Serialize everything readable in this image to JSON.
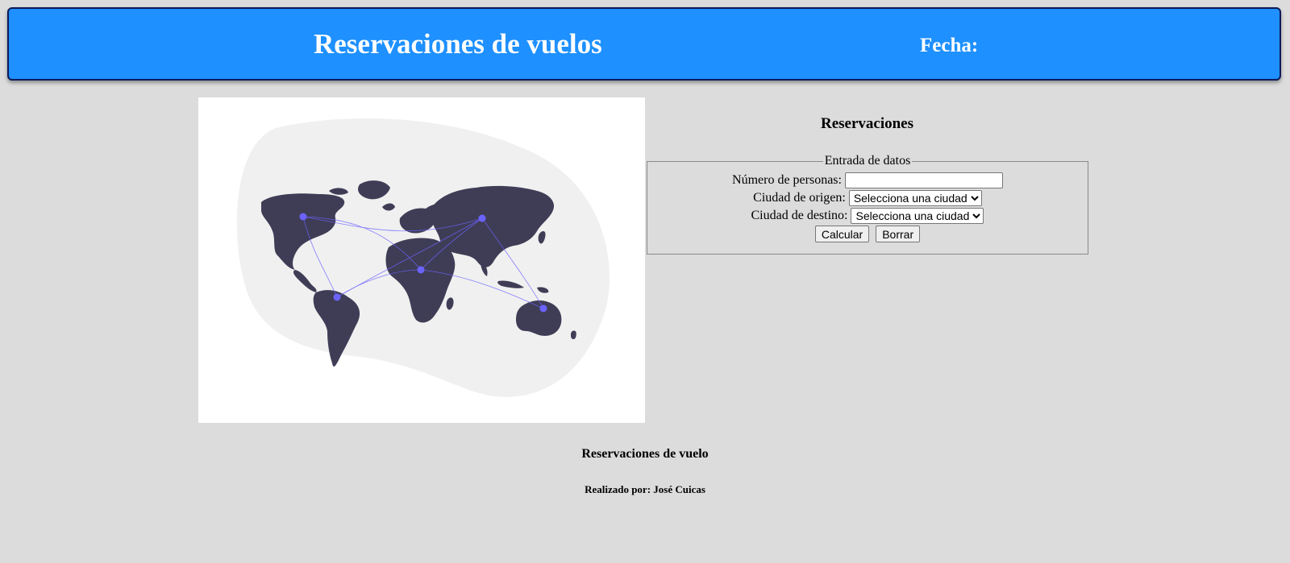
{
  "header": {
    "title": "Reservaciones de vuelos",
    "date_label": "Fecha:"
  },
  "reservations": {
    "title": "Reservaciones",
    "legend": "Entrada de datos",
    "persons_label": "Número de personas:",
    "persons_value": "",
    "origin_label": "Ciudad de origen:",
    "origin_selected": "Selecciona una ciudad",
    "destination_label": "Ciudad de destino:",
    "destination_selected": "Selecciona una ciudad",
    "calculate_label": "Calcular",
    "clear_label": "Borrar"
  },
  "footer": {
    "title": "Reservaciones de vuelo",
    "author": "Realizado por: José Cuicas"
  },
  "icons": {
    "map": "world-map-illustration",
    "select_arrow": "chevron-down-icon"
  },
  "colors": {
    "header_bg": "#1e90ff",
    "page_bg": "#dcdcdc",
    "continents": "#3f3d56",
    "route_points": "#6c63ff"
  }
}
